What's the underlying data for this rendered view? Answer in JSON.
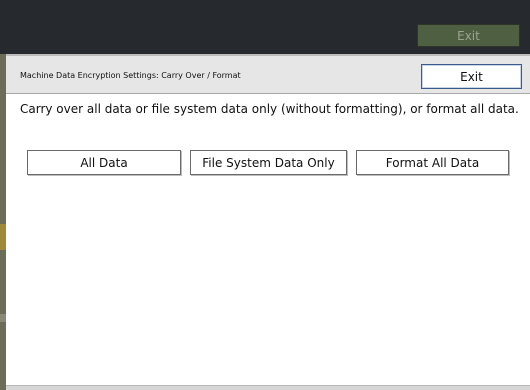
{
  "topbar": {
    "exit_label": "Exit"
  },
  "dialog": {
    "title": "Machine Data Encryption Settings: Carry Over / Format",
    "exit_label": "Exit",
    "description": "Carry over all data or file system data only (without formatting), or format all data.",
    "buttons": {
      "all_data": "All Data",
      "file_system_only": "File System Data Only",
      "format_all": "Format All Data"
    }
  },
  "colors": {
    "topbar_bg": "#262a2e",
    "topbar_exit_bg": "#4f5f41",
    "dialog_header_bg": "#e6e6e6",
    "exit_button_border": "#3b5b8c"
  }
}
